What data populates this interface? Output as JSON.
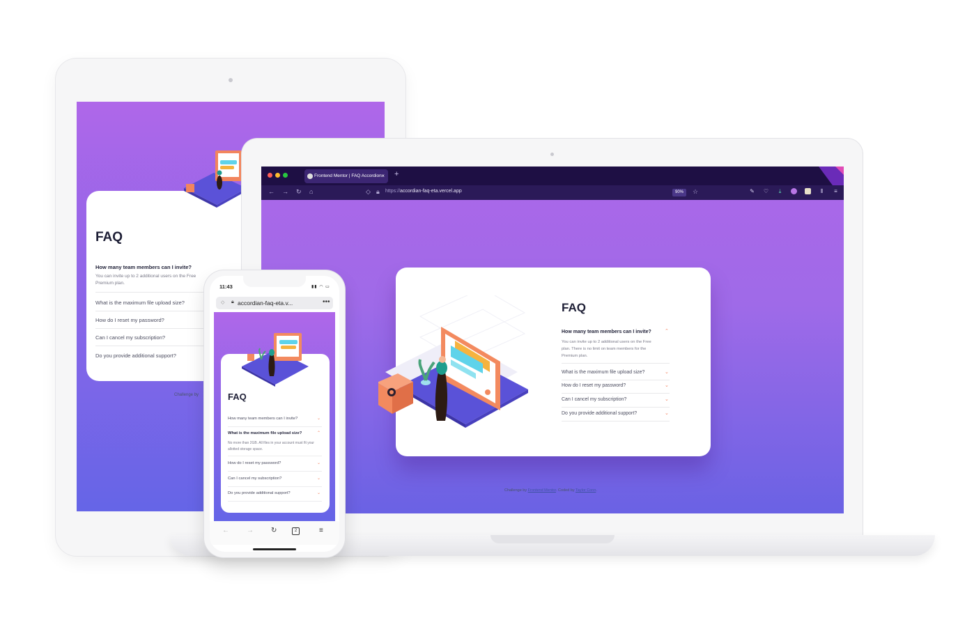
{
  "tablet": {
    "title": "FAQ",
    "faqs": [
      {
        "q": "How many team members can I invite?",
        "open": true
      },
      {
        "q": "What is the maximum file upload size?"
      },
      {
        "q": "How do I reset my password?"
      },
      {
        "q": "Can I cancel my subscription?"
      },
      {
        "q": "Do you provide additional support?"
      }
    ],
    "answer": "You can invite up to 2 additional users on the Free Premium plan.",
    "footer": "Challenge by"
  },
  "laptop": {
    "tab_title": "Frontend Mentor | FAQ Accordion",
    "url_prefix": "https://",
    "url_host": "accordian-faq-eta.vercel.app",
    "zoom": "90%",
    "title": "FAQ",
    "faqs": [
      {
        "q": "How many team members can I invite?",
        "open": true
      },
      {
        "q": "What is the maximum file upload size?"
      },
      {
        "q": "How do I reset my password?"
      },
      {
        "q": "Can I cancel my subscription?"
      },
      {
        "q": "Do you provide additional support?"
      }
    ],
    "answer": "You can invite up to 2 additional users on the Free plan. There is no limit on team members for the Premium plan.",
    "footer": {
      "prefix": "Challenge by",
      "link1": "Frontend Mentor",
      "middle": ". Coded by",
      "link2": "Taylor Conn",
      "suffix": "."
    }
  },
  "phone": {
    "time": "11:43",
    "url": "accordian-faq-eta.v...",
    "title": "FAQ",
    "faqs": [
      {
        "q": "How many team members can I invite?"
      },
      {
        "q": "What is the maximum file upload size?",
        "open": true
      },
      {
        "q": "How do I reset my password?"
      },
      {
        "q": "Can I cancel my subscription?"
      },
      {
        "q": "Do you provide additional support?"
      }
    ],
    "answer": "No more than 2GB. All files in your account must fit your allotted storage space.",
    "tab_count": "2"
  },
  "colors": {
    "accent": "#f47c57",
    "gradient_top": "#af67e9",
    "gradient_bottom": "#6565e7",
    "heading": "#1e1f36"
  },
  "icons": {
    "chevron_down": "chevron-down-icon",
    "chevron_up": "chevron-up-icon"
  }
}
